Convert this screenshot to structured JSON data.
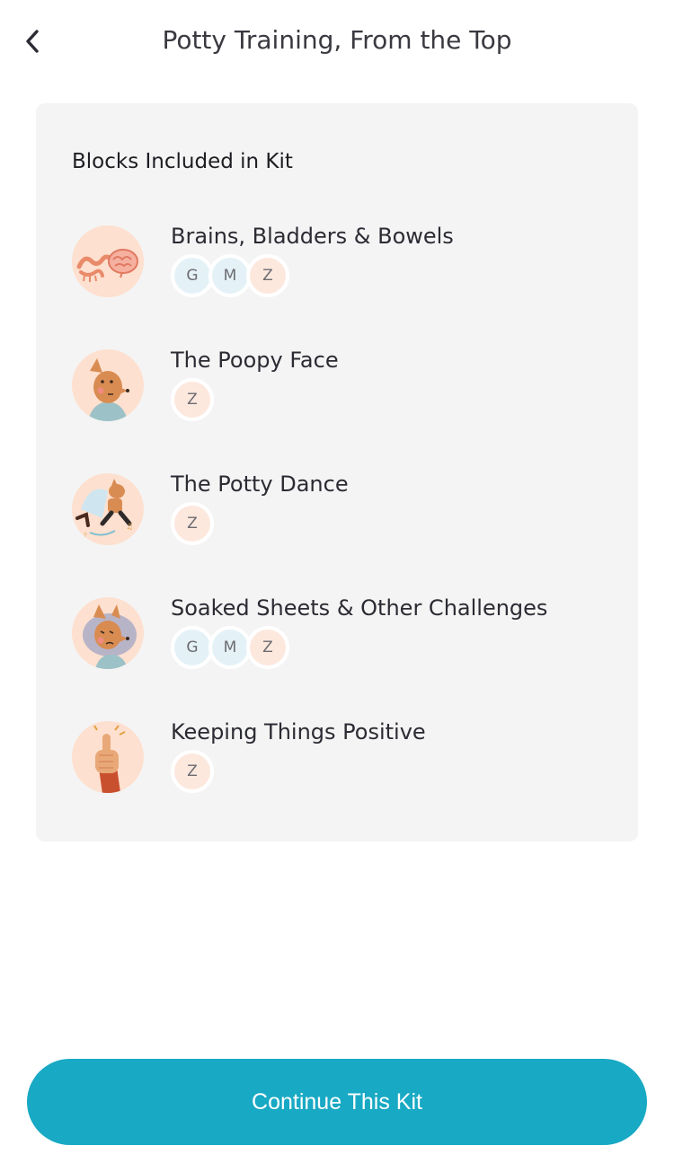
{
  "header": {
    "title": "Potty Training, From the Top",
    "back_icon": "chevron-left-icon"
  },
  "card": {
    "title": "Blocks Included in Kit",
    "blocks": [
      {
        "name": "Brains, Bladders & Bowels",
        "image": "brain-bladder-bowel-illustration",
        "chips": [
          "G",
          "M",
          "Z"
        ]
      },
      {
        "name": "The Poopy Face",
        "image": "fox-poopy-face-illustration",
        "chips": [
          "Z"
        ]
      },
      {
        "name": "The Potty Dance",
        "image": "fox-dancing-illustration",
        "chips": [
          "Z"
        ]
      },
      {
        "name": "Soaked Sheets & Other Challenges",
        "image": "fox-sad-illustration",
        "chips": [
          "G",
          "M",
          "Z"
        ]
      },
      {
        "name": "Keeping Things Positive",
        "image": "thumbs-up-illustration",
        "chips": [
          "Z"
        ]
      }
    ]
  },
  "footer": {
    "cta_label": "Continue This Kit"
  },
  "colors": {
    "accent": "#18a9c4",
    "card_bg": "#f4f4f4",
    "thumb_bg": "#fde0cf",
    "chip_blue": "#e4f2f7",
    "chip_peach": "#fde8de"
  }
}
